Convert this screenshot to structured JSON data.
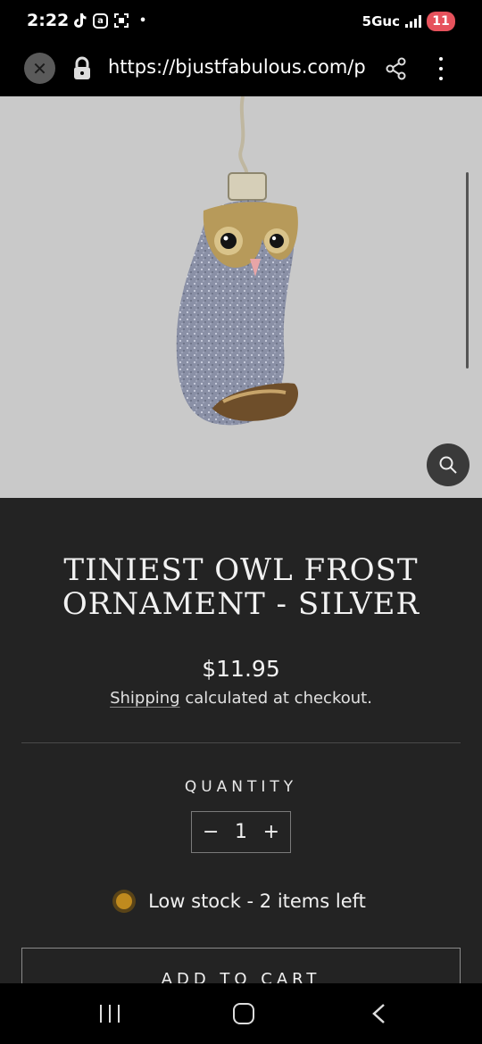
{
  "status_bar": {
    "time": "2:22",
    "network": "5Guc",
    "battery": "11",
    "icons": [
      "tiktok-icon",
      "app-icon",
      "screenshot-icon",
      "dot-icon"
    ]
  },
  "browser": {
    "url": "https://bjustfabulous.com/pr",
    "close_icon": "close-icon",
    "lock_icon": "lock-icon",
    "share_icon": "share-icon",
    "menu_icon": "more-vertical-icon"
  },
  "product": {
    "image_alt": "owl ornament",
    "zoom_icon": "search-icon",
    "title": "TINIEST OWL FROST ORNAMENT - SILVER",
    "price": "$11.95",
    "shipping_link": "Shipping",
    "shipping_rest": " calculated at checkout.",
    "quantity_label": "QUANTITY",
    "quantity_value": "1",
    "minus": "−",
    "plus": "+",
    "stock_text": "Low stock - 2 items left",
    "add_to_cart": "ADD TO CART"
  },
  "colors": {
    "page_bg": "#232323",
    "image_bg": "#c9c9c9",
    "stock_dot": "#c08a1e",
    "battery_badge": "#e6525c"
  }
}
